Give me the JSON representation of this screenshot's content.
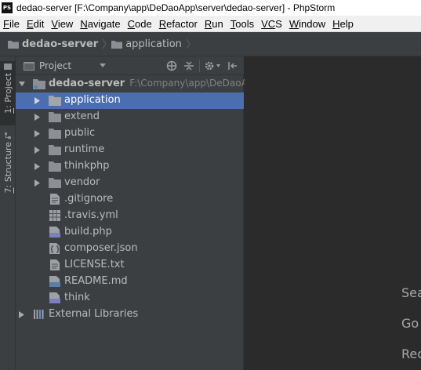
{
  "window": {
    "app_icon_text": "PS",
    "title": "dedao-server [F:\\Company\\app\\DeDaoApp\\server\\dedao-server] - PhpStorm"
  },
  "menu": [
    {
      "first": "F",
      "rest": "ile"
    },
    {
      "first": "E",
      "rest": "dit"
    },
    {
      "first": "V",
      "rest": "iew"
    },
    {
      "first": "N",
      "rest": "avigate"
    },
    {
      "first": "C",
      "rest": "ode"
    },
    {
      "first": "R",
      "rest": "efactor"
    },
    {
      "first": "R",
      "rest": "un"
    },
    {
      "first": "T",
      "rest": "ools"
    },
    {
      "first": "VC",
      "rest": "S"
    },
    {
      "first": "W",
      "rest": "indow"
    },
    {
      "first": "H",
      "rest": "elp"
    }
  ],
  "breadcrumb": {
    "root": "dedao-server",
    "child": "application"
  },
  "tool_strip": {
    "project_tab": {
      "num": "1",
      "text": ": Project"
    },
    "structure_tab": {
      "num": "7",
      "text": ": Structure"
    }
  },
  "project_panel": {
    "header_label": "Project",
    "root": {
      "name": "dedao-server",
      "path": "F:\\Company\\app\\DeDaoApp"
    },
    "items": [
      {
        "name": "application",
        "kind": "folder",
        "selected": true
      },
      {
        "name": "extend",
        "kind": "folder"
      },
      {
        "name": "public",
        "kind": "folder"
      },
      {
        "name": "runtime",
        "kind": "folder"
      },
      {
        "name": "thinkphp",
        "kind": "folder"
      },
      {
        "name": "vendor",
        "kind": "folder"
      },
      {
        "name": ".gitignore",
        "kind": "file-text"
      },
      {
        "name": ".travis.yml",
        "kind": "file-yml"
      },
      {
        "name": "build.php",
        "kind": "file-php"
      },
      {
        "name": "composer.json",
        "kind": "file-json"
      },
      {
        "name": "LICENSE.txt",
        "kind": "file-text"
      },
      {
        "name": "README.md",
        "kind": "file-md"
      },
      {
        "name": "think",
        "kind": "file-php"
      }
    ],
    "external_libraries": "External Libraries"
  },
  "editor": {
    "hint_1": "Sea",
    "hint_2": "Go",
    "hint_3": "Rec"
  },
  "colors": {
    "selection": "#4b6eaf",
    "panel_bg": "#3c3f41",
    "editor_bg": "#2b2b2b",
    "text": "#bbbbbb"
  }
}
